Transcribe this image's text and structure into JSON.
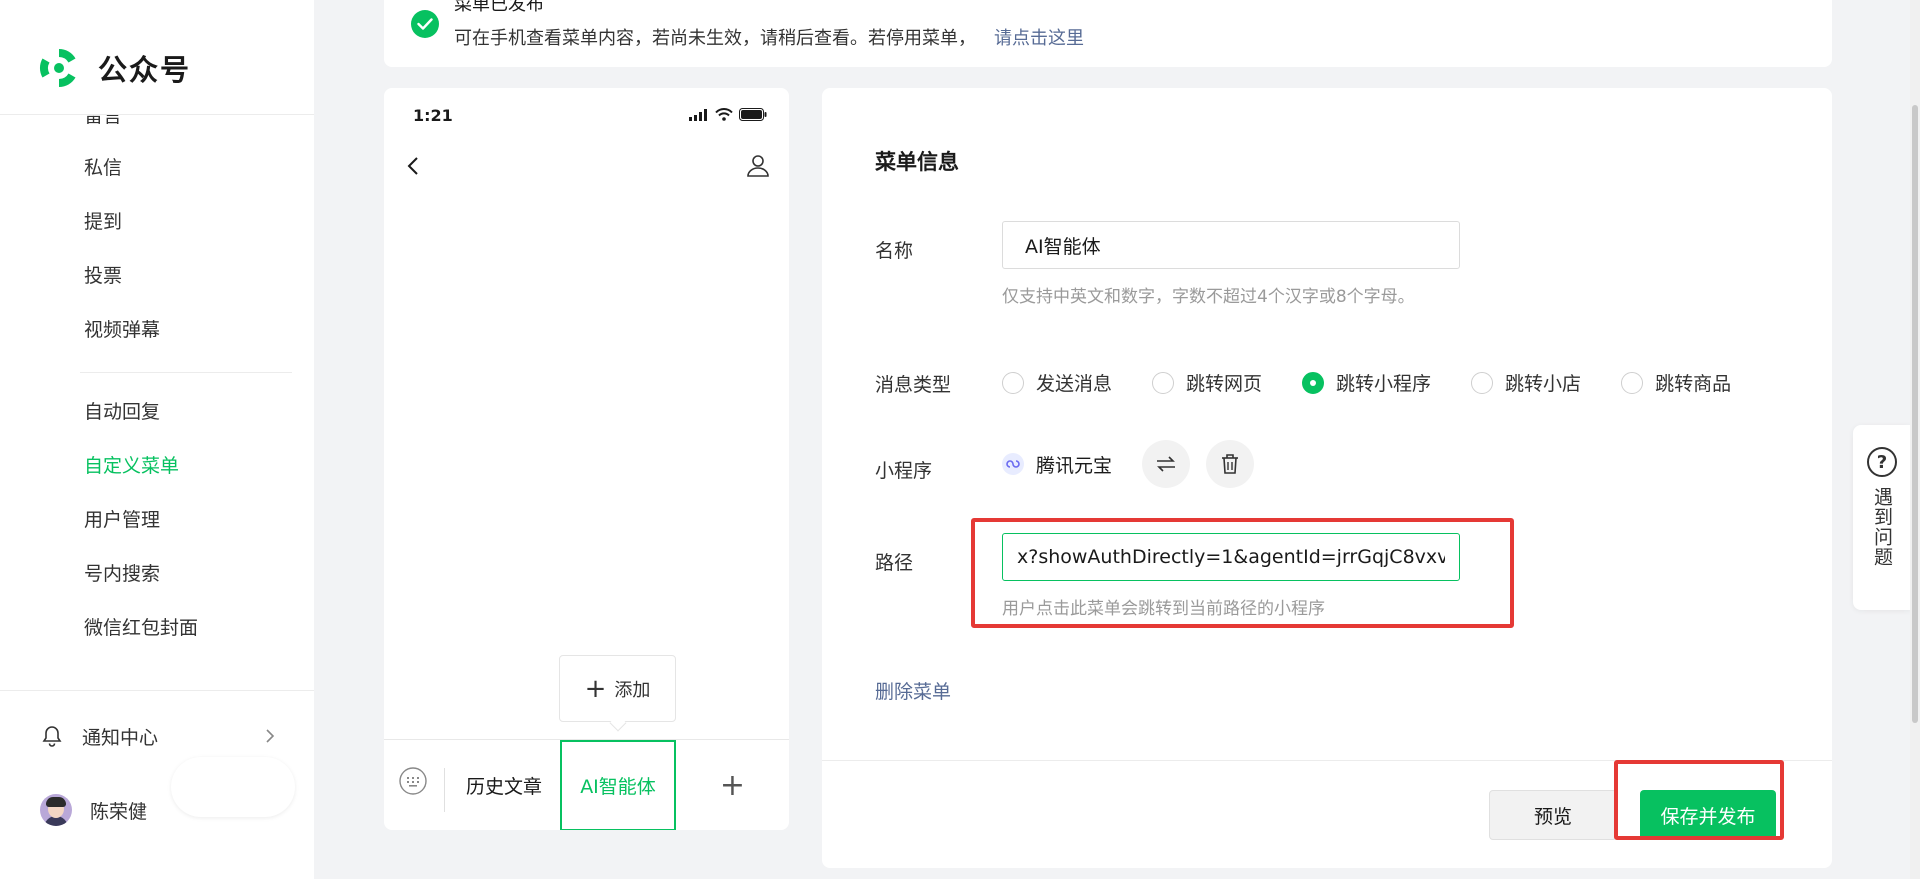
{
  "sidebar": {
    "brand": "公众号",
    "nav_cut_label": "留言",
    "nav_group1": [
      "私信",
      "提到",
      "投票",
      "视频弹幕"
    ],
    "nav_group2": [
      "自定义菜单",
      "用户管理",
      "号内搜索",
      "微信红包封面"
    ],
    "nav_auto_reply": "自动回复",
    "notification_label": "通知中心",
    "user_name": "陈荣健"
  },
  "notice": {
    "title": "菜单已发布",
    "desc": "可在手机查看菜单内容，若尚未生效，请稍后查看。若停用菜单，",
    "link": "请点击这里"
  },
  "phone": {
    "time": "1:21",
    "add_label": "添加",
    "add_plus": "+",
    "menu_history": "历史文章",
    "menu_ai": "AI智能体",
    "menu_add": "+"
  },
  "panel": {
    "title": "菜单信息",
    "name_label": "名称",
    "name_value": "AI智能体",
    "name_hint": "仅支持中英文和数字，字数不超过4个汉字或8个字母。",
    "msg_type_label": "消息类型",
    "msg_types": [
      "发送消息",
      "跳转网页",
      "跳转小程序",
      "跳转小店",
      "跳转商品"
    ],
    "msg_type_selected": "跳转小程序",
    "mini_label": "小程序",
    "mini_name": "腾讯元宝",
    "path_label": "路径",
    "path_value": "x?showAuthDirectly=1&agentId=jrrGqjC8vxv",
    "path_hint": "用户点击此菜单会跳转到当前路径的小程序",
    "delete_label": "删除菜单",
    "preview_label": "预览",
    "publish_label": "保存并发布"
  },
  "help": {
    "icon": "?",
    "label": "遇到问题"
  },
  "colors": {
    "accent": "#07c160",
    "link": "#576b95",
    "highlight_box": "#e53935"
  }
}
